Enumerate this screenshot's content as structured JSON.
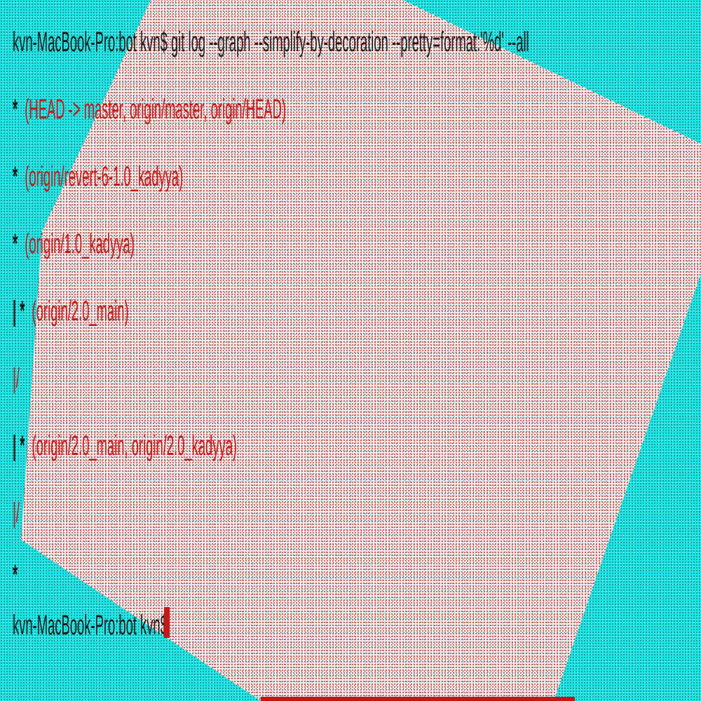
{
  "terminal": {
    "command_prompt": "kvn-MacBook-Pro:bot kvn$",
    "command": "git log --graph --simplify-by-decoration --pretty=format:'%d' --all",
    "graph": [
      {
        "prefix": "*",
        "refs": "(HEAD -> master, origin/master, origin/HEAD)"
      },
      {
        "prefix": "*",
        "refs": "(origin/revert-6-1.0_kadyya)"
      },
      {
        "prefix": "*",
        "refs": "(origin/1.0_kadyya)"
      },
      {
        "prefix": "| *",
        "refs": "(origin/2.0_main)"
      },
      {
        "prefix": "|/",
        "refs": ""
      },
      {
        "prefix": "| *",
        "refs": "(origin/2.0_main, origin/2.0_kadyya)"
      },
      {
        "prefix": "|/",
        "refs": ""
      },
      {
        "prefix": "*",
        "refs": ""
      }
    ],
    "final_prompt": "kvn-MacBook-Pro:bot kvn$"
  },
  "colors": {
    "background": "#1ee6e6",
    "panel": "#f2ecec",
    "ref_text": "#c61818",
    "plain_text": "#231a1a"
  }
}
